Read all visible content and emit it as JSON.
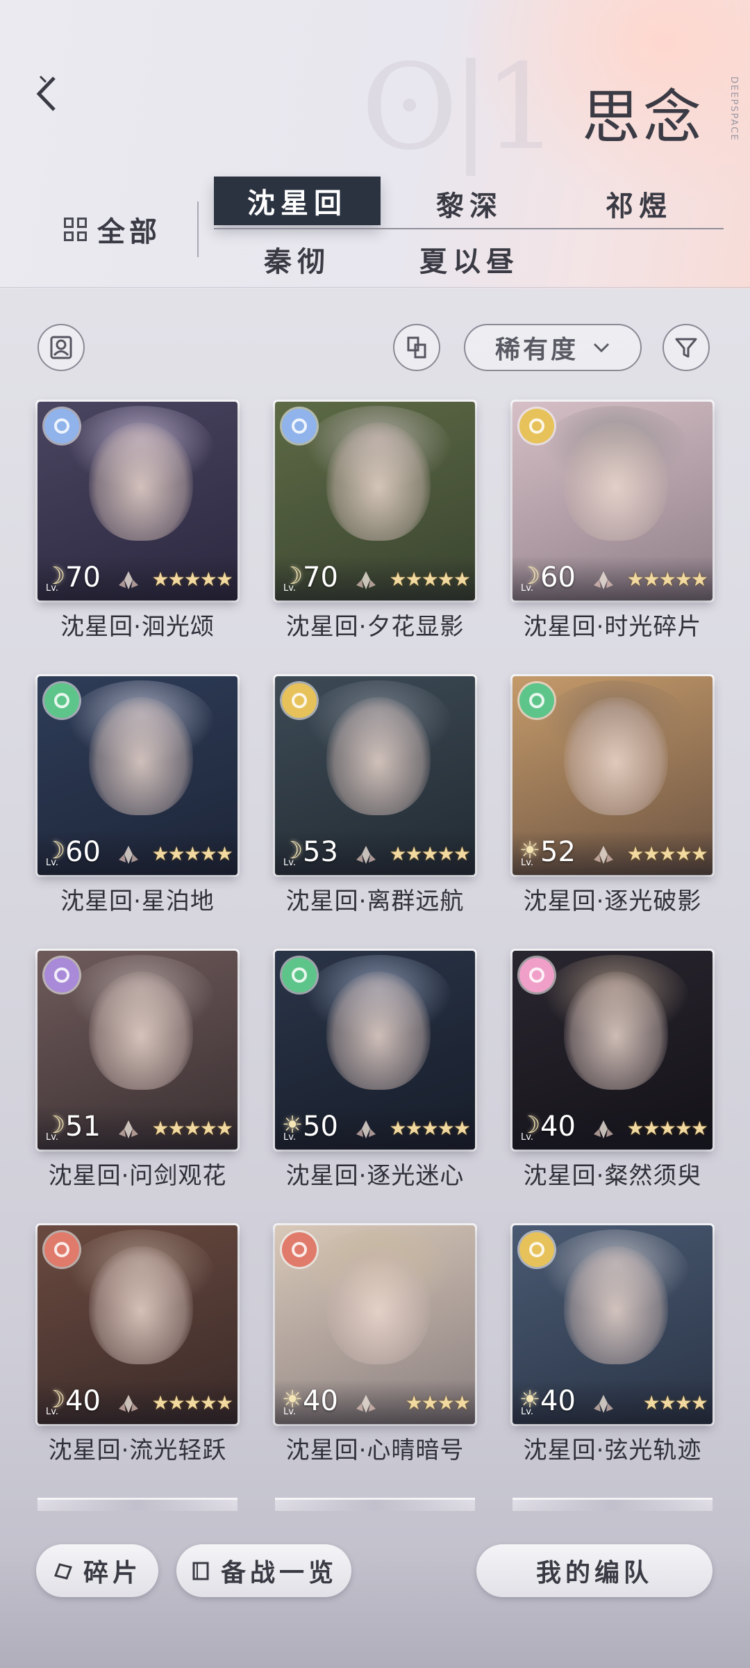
{
  "header": {
    "title": "思念",
    "brand_vertical": "DEEPSPACE",
    "filter_all_label": "全部",
    "tabs": [
      {
        "label": "沈星回",
        "active": true
      },
      {
        "label": "黎深",
        "active": false
      },
      {
        "label": "祁煜",
        "active": false
      },
      {
        "label": "秦彻",
        "active": false
      },
      {
        "label": "夏以昼",
        "active": false
      }
    ]
  },
  "toolbar": {
    "sort_label": "稀有度",
    "sort_icon": "chevron-down-icon",
    "left_button_icon": "portrait-frame-icon",
    "layout_button_icon": "swap-icon",
    "filter_button_icon": "funnel-icon"
  },
  "cards": [
    {
      "name": "沈星回·洄光颂",
      "level": "70",
      "lv_prefix": "Lv.",
      "attr_color": "#8fb3ea",
      "type": "moon",
      "stars": 5,
      "bg1": "#4a4560",
      "bg2": "#2c2840",
      "hair": "#a79cb8"
    },
    {
      "name": "沈星回·夕花显影",
      "level": "70",
      "lv_prefix": "Lv.",
      "attr_color": "#8fb3ea",
      "type": "moon",
      "stars": 5,
      "bg1": "#5d6a45",
      "bg2": "#3a4430",
      "hair": "#a8a49c"
    },
    {
      "name": "沈星回·时光碎片",
      "level": "60",
      "lv_prefix": "Lv.",
      "attr_color": "#e7c25a",
      "type": "moon",
      "stars": 5,
      "bg1": "#d6bfc6",
      "bg2": "#8f7f88",
      "hair": "#9b9598"
    },
    {
      "name": "沈星回·星泊地",
      "level": "60",
      "lv_prefix": "Lv.",
      "attr_color": "#5ec58a",
      "type": "moon",
      "stars": 5,
      "bg1": "#2f3d58",
      "bg2": "#1d2538",
      "hair": "#9fa3b6"
    },
    {
      "name": "沈星回·离群远航",
      "level": "53",
      "lv_prefix": "Lv.",
      "attr_color": "#e7c25a",
      "type": "moon",
      "stars": 5,
      "bg1": "#3d4a55",
      "bg2": "#222b33",
      "hair": "#6e7884"
    },
    {
      "name": "沈星回·逐光破影",
      "level": "52",
      "lv_prefix": "Lv.",
      "attr_color": "#5ec58a",
      "type": "sun",
      "stars": 5,
      "bg1": "#c49a6a",
      "bg2": "#6b5342",
      "hair": "#8f7660"
    },
    {
      "name": "沈星回·问剑观花",
      "level": "51",
      "lv_prefix": "Lv.",
      "attr_color": "#a98ad8",
      "type": "moon",
      "stars": 5,
      "bg1": "#6f5a5a",
      "bg2": "#3a3032",
      "hair": "#a09290"
    },
    {
      "name": "沈星回·逐光迷心",
      "level": "50",
      "lv_prefix": "Lv.",
      "attr_color": "#5ec58a",
      "type": "sun",
      "stars": 5,
      "bg1": "#2a3548",
      "bg2": "#171d2a",
      "hair": "#7e8aa2"
    },
    {
      "name": "沈星回·粲然须臾",
      "level": "40",
      "lv_prefix": "Lv.",
      "attr_color": "#f0a0c8",
      "type": "moon",
      "stars": 5,
      "bg1": "#2a2630",
      "bg2": "#141218",
      "hair": "#8a7a6e"
    },
    {
      "name": "沈星回·流光轻跃",
      "level": "40",
      "lv_prefix": "Lv.",
      "attr_color": "#e07a6a",
      "type": "moon",
      "stars": 5,
      "bg1": "#6a4a40",
      "bg2": "#3a2a28",
      "hair": "#9a8478"
    },
    {
      "name": "沈星回·心晴暗号",
      "level": "40",
      "lv_prefix": "Lv.",
      "attr_color": "#e07a6a",
      "type": "sun",
      "stars": 4,
      "bg1": "#d8c8b8",
      "bg2": "#8a7f80",
      "hair": "#c7b8a0"
    },
    {
      "name": "沈星回·弦光轨迹",
      "level": "40",
      "lv_prefix": "Lv.",
      "attr_color": "#e7c25a",
      "type": "sun",
      "stars": 4,
      "bg1": "#4a5a72",
      "bg2": "#2a3446",
      "hair": "#a9abb4"
    }
  ],
  "bottom": {
    "fragments_label": "碎片",
    "prepare_label": "备战一览",
    "team_label": "我的编队"
  }
}
